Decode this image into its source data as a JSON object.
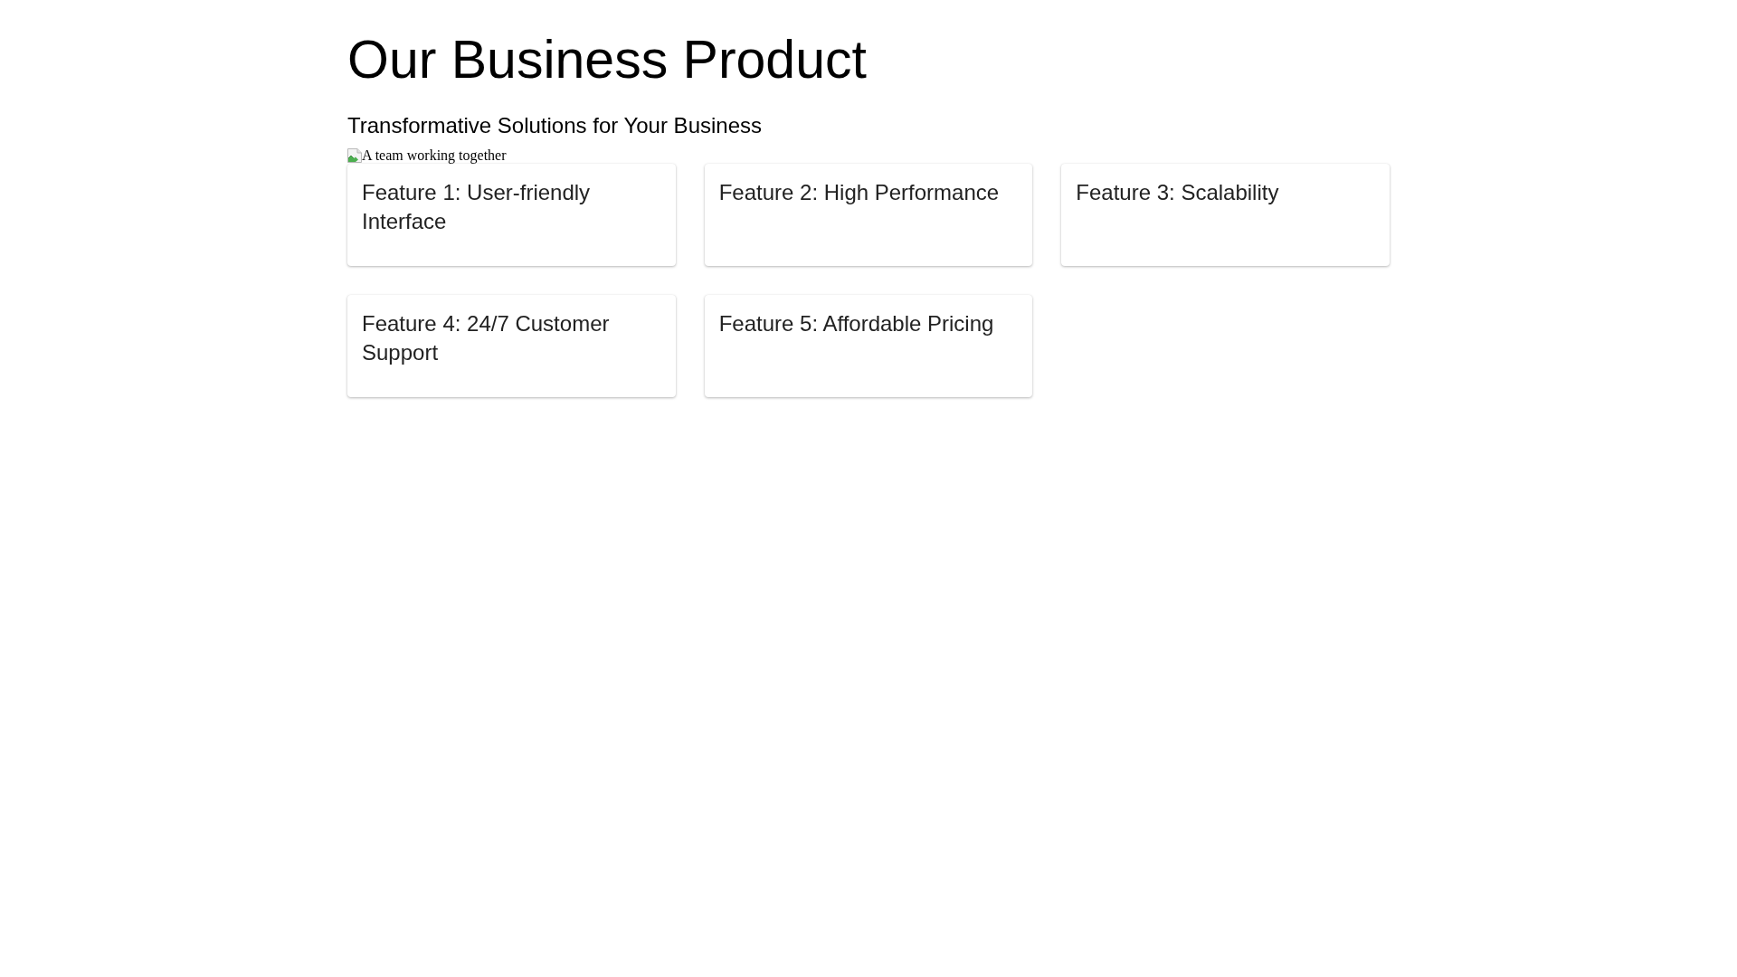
{
  "title": "Our Business Product",
  "subtitle": "Transformative Solutions for Your Business",
  "image": {
    "alt": "A team working together"
  },
  "features": [
    {
      "title": "Feature 1: User-friendly Interface"
    },
    {
      "title": "Feature 2: High Performance"
    },
    {
      "title": "Feature 3: Scalability"
    },
    {
      "title": "Feature 4: 24/7 Customer Support"
    },
    {
      "title": "Feature 5: Affordable Pricing"
    }
  ]
}
